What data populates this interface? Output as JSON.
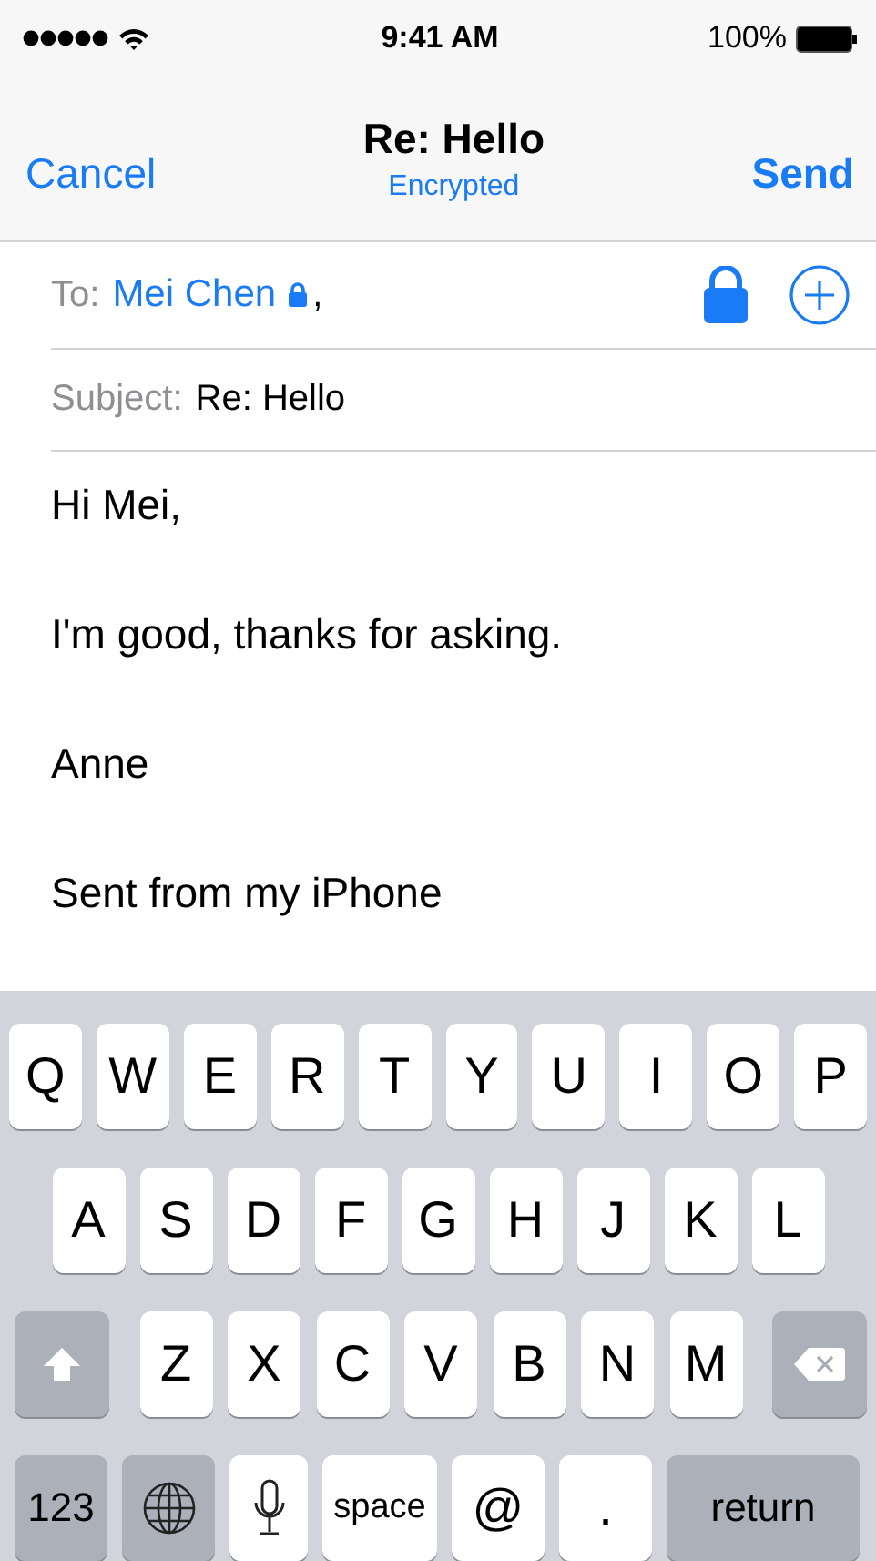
{
  "status_bar": {
    "time": "9:41 AM",
    "battery": "100%"
  },
  "nav": {
    "cancel": "Cancel",
    "title": "Re: Hello",
    "subtitle": "Encrypted",
    "send": "Send"
  },
  "to": {
    "label": "To:",
    "recipient": "Mei Chen",
    "separator": ","
  },
  "subject": {
    "label": "Subject:",
    "value": "Re: Hello"
  },
  "body": [
    "Hi Mei,",
    "I'm good, thanks for asking.",
    "Anne",
    "Sent from my iPhone"
  ],
  "keyboard": [
    [
      {
        "kind": "letter",
        "label": "Q"
      },
      {
        "kind": "letter",
        "label": "W"
      },
      {
        "kind": "letter",
        "label": "E"
      },
      {
        "kind": "letter",
        "label": "R"
      },
      {
        "kind": "letter",
        "label": "T"
      },
      {
        "kind": "letter",
        "label": "Y"
      },
      {
        "kind": "letter",
        "label": "U"
      },
      {
        "kind": "letter",
        "label": "I"
      },
      {
        "kind": "letter",
        "label": "O"
      },
      {
        "kind": "letter",
        "label": "P"
      }
    ],
    [
      {
        "kind": "letter",
        "label": "A"
      },
      {
        "kind": "letter",
        "label": "S"
      },
      {
        "kind": "letter",
        "label": "D"
      },
      {
        "kind": "letter",
        "label": "F"
      },
      {
        "kind": "letter",
        "label": "G"
      },
      {
        "kind": "letter",
        "label": "H"
      },
      {
        "kind": "letter",
        "label": "J"
      },
      {
        "kind": "letter",
        "label": "K"
      },
      {
        "kind": "letter",
        "label": "L"
      }
    ],
    [
      {
        "kind": "shift"
      },
      {
        "kind": "letter",
        "label": "Z"
      },
      {
        "kind": "letter",
        "label": "X"
      },
      {
        "kind": "letter",
        "label": "C"
      },
      {
        "kind": "letter",
        "label": "V"
      },
      {
        "kind": "letter",
        "label": "B"
      },
      {
        "kind": "letter",
        "label": "N"
      },
      {
        "kind": "letter",
        "label": "M"
      },
      {
        "kind": "delete"
      }
    ],
    [
      {
        "kind": "numbers",
        "label": "123"
      },
      {
        "kind": "globe"
      },
      {
        "kind": "mic"
      },
      {
        "kind": "space",
        "label": "space"
      },
      {
        "kind": "symbol",
        "label": "@"
      },
      {
        "kind": "symbol",
        "label": "."
      },
      {
        "kind": "return",
        "label": "return"
      }
    ]
  ]
}
